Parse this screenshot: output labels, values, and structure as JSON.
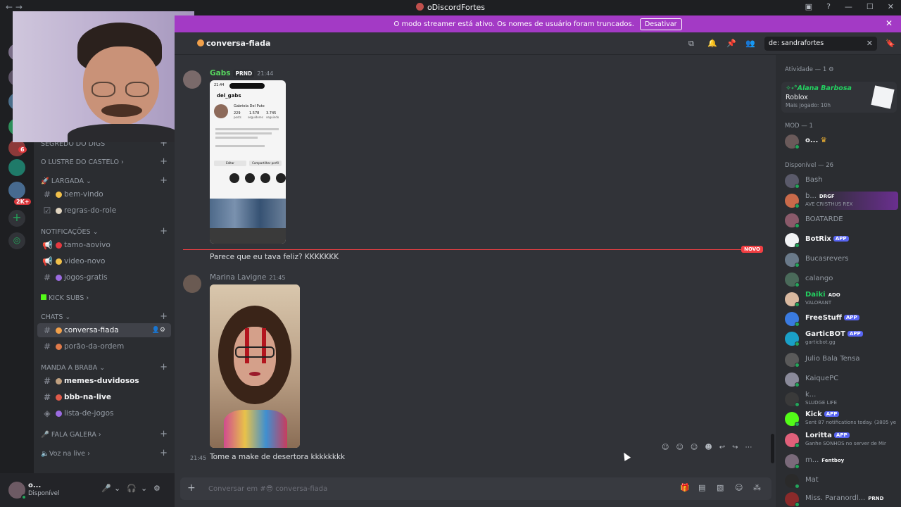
{
  "window": {
    "title": "oDiscordFortes"
  },
  "banner": {
    "text": "O modo streamer está ativo. Os nomes de usuário foram truncados.",
    "button": "Desativar"
  },
  "channel_header": {
    "name": "conversa-fiada",
    "search_value": "de: sandrafortes"
  },
  "sidebar": {
    "categories": [
      {
        "name": "SEGREDO DO DIGS"
      },
      {
        "name": "O LUSTRE DO CASTELO",
        "chevron": "›"
      },
      {
        "name": "🚀 LARGADA",
        "chevron": "⌄"
      },
      {
        "name": "NOTIFICAÇÕES",
        "chevron": "⌄"
      },
      {
        "name": "KICK SUBS",
        "chevron": "›"
      },
      {
        "name": "CHATS",
        "chevron": "⌄"
      },
      {
        "name": "MANDA A BRABA",
        "chevron": "⌄"
      },
      {
        "name": "FALA GALERA",
        "chevron": "›"
      },
      {
        "name": "Voz na live",
        "chevron": "›"
      }
    ],
    "channels": [
      {
        "name": "bem-vindo",
        "icon": "hash-icon"
      },
      {
        "name": "regras-do-role",
        "icon": "rules-icon"
      },
      {
        "name": "tamo-aovivo",
        "icon": "megaphone-icon"
      },
      {
        "name": "video-novo",
        "icon": "megaphone-icon"
      },
      {
        "name": "jogos-gratis",
        "icon": "hash-icon"
      },
      {
        "name": "conversa-fiada",
        "icon": "hash-icon"
      },
      {
        "name": "porão-da-ordem",
        "icon": "hash-icon"
      },
      {
        "name": "memes-duvidosos",
        "icon": "hash-icon"
      },
      {
        "name": "bbb-na-live",
        "icon": "hash-icon"
      },
      {
        "name": "lista-de-jogos",
        "icon": "hash-icon"
      }
    ],
    "server_badges": {
      "first": "6",
      "second": "2K+"
    }
  },
  "user_panel": {
    "name": "o...",
    "status": "Disponível"
  },
  "messages": {
    "gabs": {
      "author": "Gabs",
      "tag": "PRND",
      "time": "21:44"
    },
    "phone_screenshot": {
      "time": "21:44",
      "username": "del_gabs",
      "display_name": "Gabriela Del Puto",
      "stats": [
        "229",
        "1.578",
        "3.745"
      ],
      "stat_labels": [
        "posts",
        "seguidores",
        "seguindo"
      ],
      "edit": "Editar",
      "share": "Compartilhar perfil"
    },
    "new_divider": "NOVO",
    "gabs_text": "Parece que eu tava feliz? KKKKKKK",
    "marina": {
      "author": "Marina Lavigne",
      "time": "21:45"
    },
    "marina_reply": {
      "time": "21:45",
      "text": "Tome a make de desertora kkkkkkkk"
    }
  },
  "composer": {
    "placeholder": "Conversar em #😎 conversa-fiada"
  },
  "members": {
    "activity_header": "Atividade — 1",
    "activity": {
      "name": "✧˖°Alana Barbosa",
      "game": "Roblox",
      "time": "Mais jogado: 10h"
    },
    "mod_header": "MOD — 1",
    "mod_member": {
      "name": "o..."
    },
    "available_header": "Disponível — 26",
    "list": [
      {
        "name": "Bash",
        "sub": ""
      },
      {
        "name": "b...",
        "badge": "DRGF",
        "sub": "AVE CRISTHUS REX"
      },
      {
        "name": "BOATARDE",
        "sub": ""
      },
      {
        "name": "BotRix",
        "app": "APP",
        "sub": ""
      },
      {
        "name": "Bucasrevers",
        "sub": ""
      },
      {
        "name": "calango",
        "sub": ""
      },
      {
        "name": "Daiki",
        "badge": "ADO",
        "sub": "VALORANT"
      },
      {
        "name": "FreeStuff",
        "app": "APP",
        "sub": ""
      },
      {
        "name": "GarticBOT",
        "app": "APP",
        "sub": "garticbot.gg"
      },
      {
        "name": "Julio Bala Tensa",
        "sub": ""
      },
      {
        "name": "KaiquePC",
        "sub": ""
      },
      {
        "name": "k...",
        "sub": "SLUDGE LIFE"
      },
      {
        "name": "Kick",
        "app": "APP",
        "sub": "Sent 87 notifications today. (3805 ye"
      },
      {
        "name": "Loritta",
        "app": "APP",
        "sub": "Ganhe SONHOS no server de Mir"
      },
      {
        "name": "m...",
        "badge": "Fentboy",
        "sub": ""
      },
      {
        "name": "Mat",
        "sub": ""
      },
      {
        "name": "Miss. Paranordl...",
        "badge": "PRND",
        "sub": ""
      }
    ]
  },
  "colors": {
    "brand": "#5865f2",
    "banner": "#a33ac5",
    "online": "#23a55a",
    "new": "#f23f43"
  }
}
